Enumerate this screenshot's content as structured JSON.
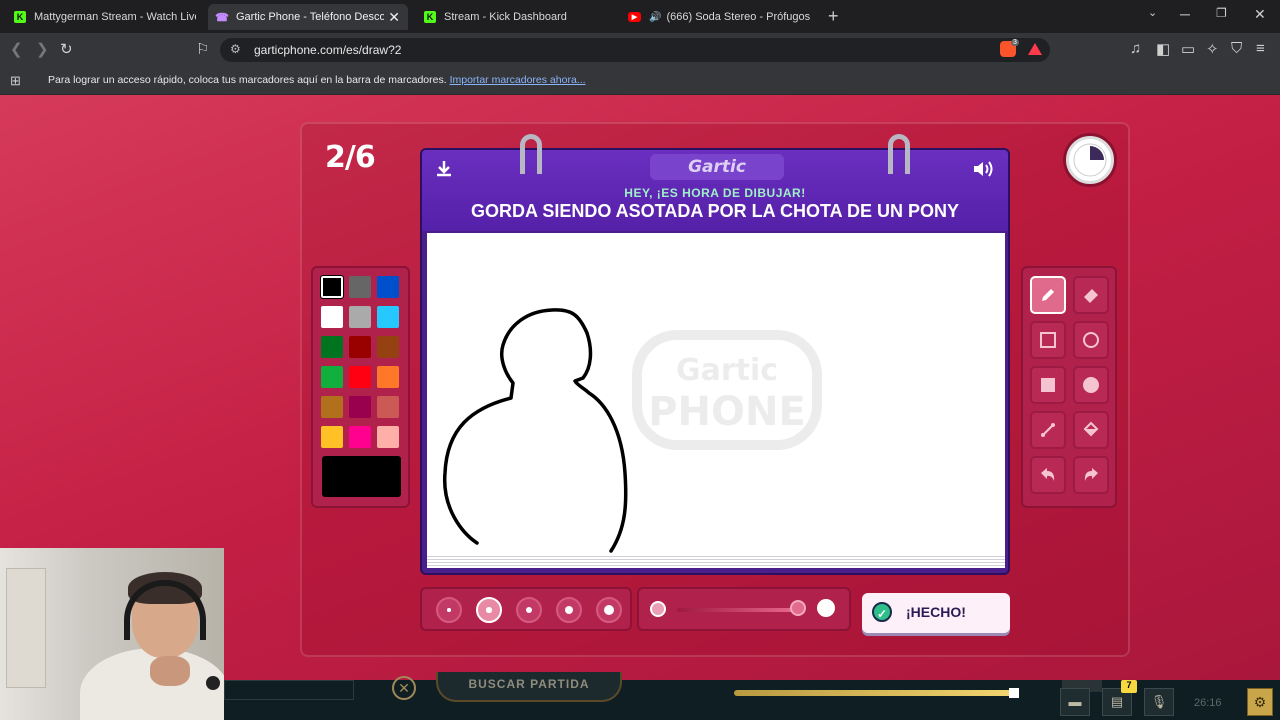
{
  "browser": {
    "tabs": [
      {
        "label": "Mattygerman Stream - Watch Live on",
        "icon": "kick-logo"
      },
      {
        "label": "Gartic Phone - Teléfono Descomp",
        "icon": "gartic-phone-icon",
        "active": true
      },
      {
        "label": "Stream - Kick Dashboard",
        "icon": "kick-logo"
      },
      {
        "label": "(666) Soda Stereo - Prófugos (Let",
        "icon": "youtube-icon"
      }
    ],
    "url": "garticphone.com/es/draw?2",
    "brave_badge": "3",
    "bookmarks_message": "Para lograr un acceso rápido, coloca tus marcadores aquí en la barra de marcadores.",
    "bookmarks_link": "Importar marcadores ahora..."
  },
  "game": {
    "round": "2/6",
    "logo": "Gartic",
    "subtitle": "HEY, ¡ES HORA DE DIBUJAR!",
    "phrase": "GORDA SIENDO ASOTADA POR LA CHOTA DE UN PONY",
    "timer_fraction_elapsed": 0.25,
    "watermark_top": "Gartic",
    "watermark_bottom": "PHONE",
    "palette": [
      "#000000",
      "#666666",
      "#0050cd",
      "#ffffff",
      "#aaaaaa",
      "#26c9ff",
      "#017420",
      "#990000",
      "#964112",
      "#11b03c",
      "#ff0013",
      "#ff7829",
      "#b0701c",
      "#99004e",
      "#cb5a57",
      "#ffc126",
      "#ff008f",
      "#feafa8"
    ],
    "selected_color": "#000000",
    "tools": [
      "pencil-icon",
      "eraser-icon",
      "square-outline-icon",
      "circle-outline-icon",
      "square-filled-icon",
      "circle-filled-icon",
      "line-icon",
      "fill-bucket-icon",
      "undo-icon",
      "redo-icon"
    ],
    "brush_sizes": [
      1,
      2,
      3,
      4,
      5
    ],
    "selected_brush_size": 2,
    "opacity": 1.0,
    "done_label": "¡HECHO!"
  },
  "overlay": {
    "search_label": "BUSCAR PARTIDA",
    "badge": "7",
    "time": "26:16"
  }
}
